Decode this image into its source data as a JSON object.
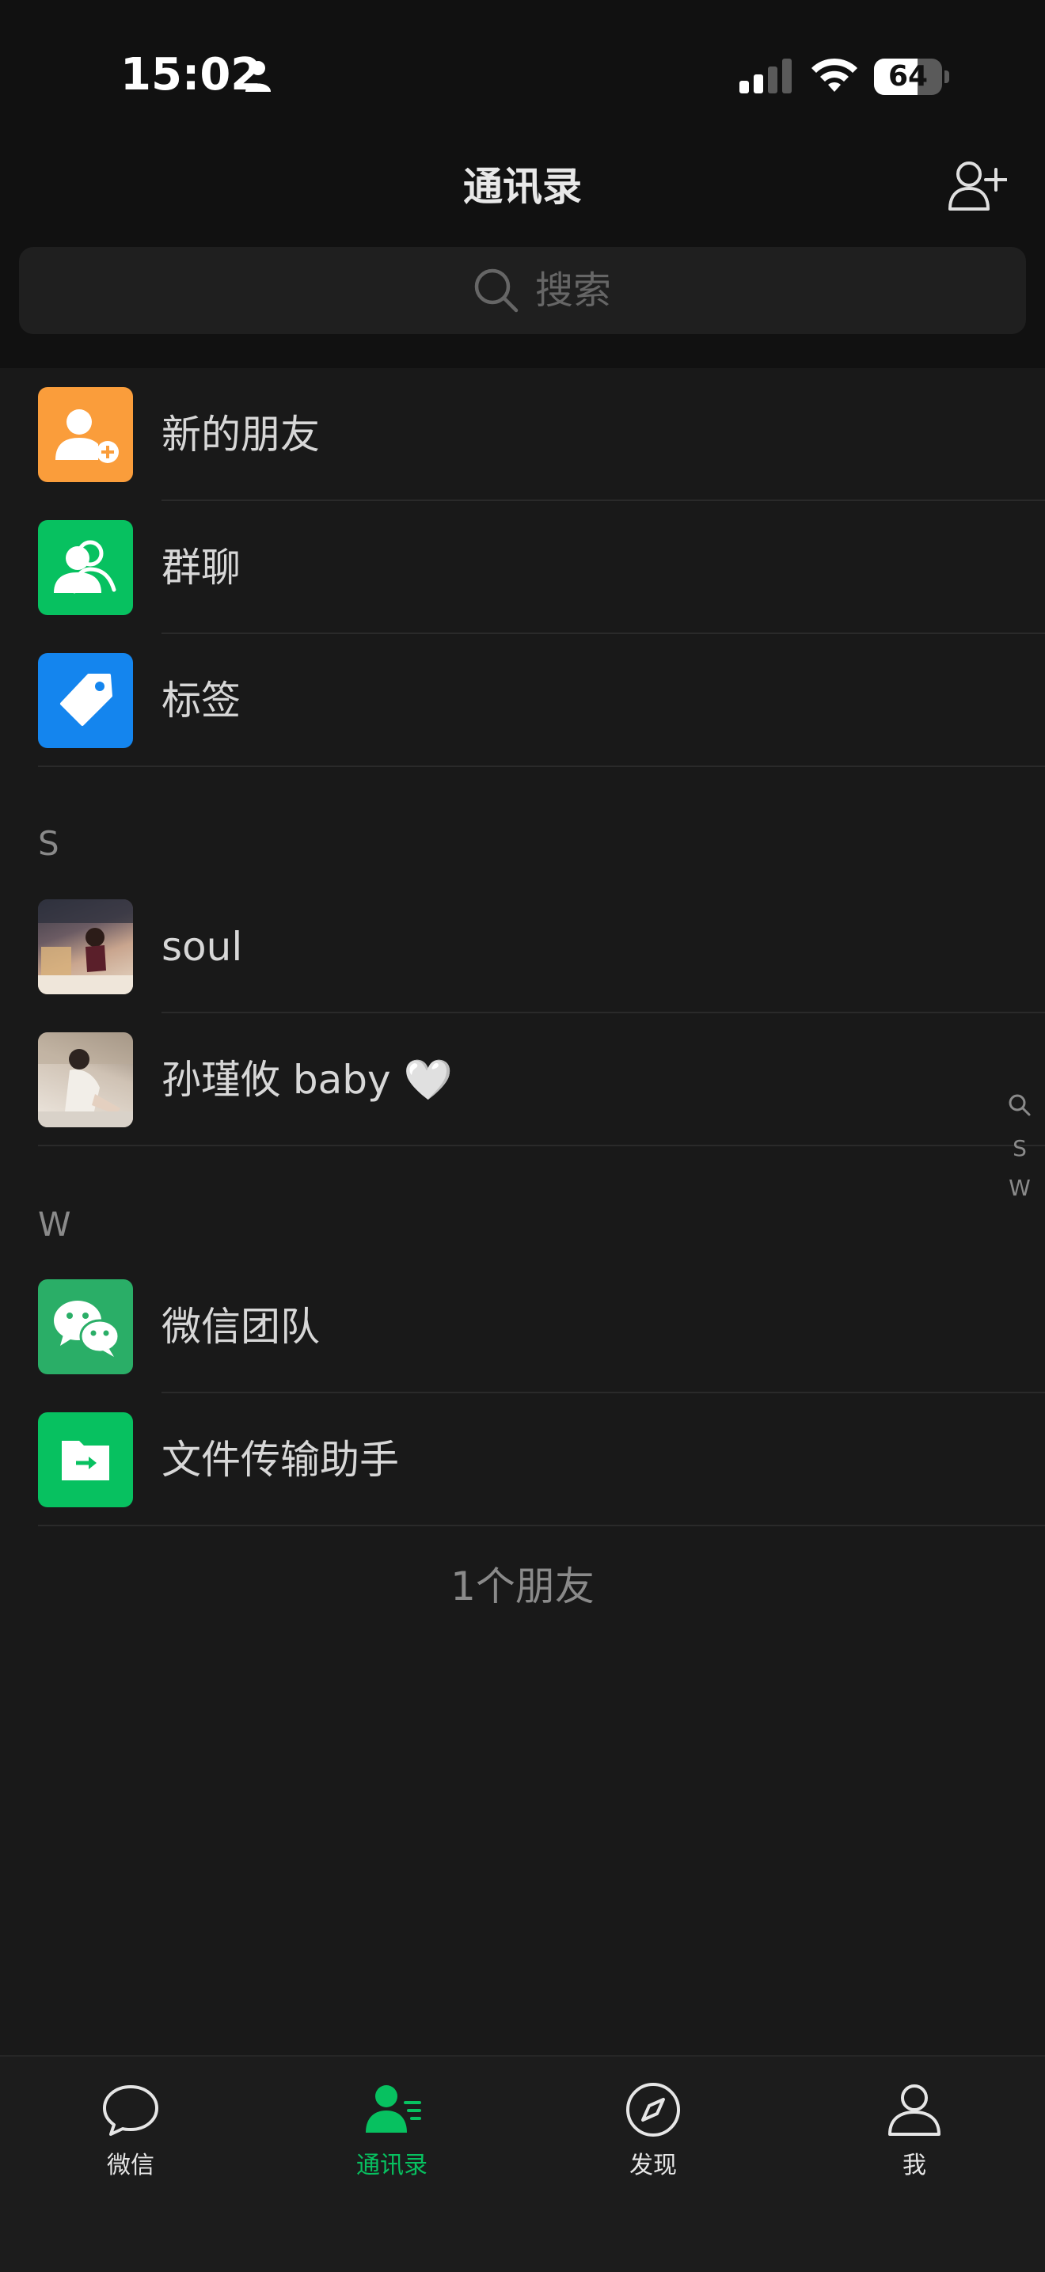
{
  "status_bar": {
    "time": "15:02",
    "battery": "64",
    "battery_level": 0.64
  },
  "header": {
    "title": "通讯录",
    "add_friend_icon": "add-contact-icon"
  },
  "search": {
    "placeholder": "搜索"
  },
  "system_items": [
    {
      "label": "新的朋友",
      "icon": "new-friend-icon",
      "color": "#fa9d3b"
    },
    {
      "label": "群聊",
      "icon": "group-chat-icon",
      "color": "#07c160"
    },
    {
      "label": "标签",
      "icon": "tag-icon",
      "color": "#1485ee"
    }
  ],
  "sections": [
    {
      "letter": "S",
      "contacts": [
        {
          "name": "soul"
        },
        {
          "name": "孙瑾攸 baby 🤍"
        }
      ]
    },
    {
      "letter": "W",
      "contacts": [
        {
          "name": "微信团队",
          "icon": "wechat-icon",
          "color": "#2aae67"
        },
        {
          "name": "文件传输助手",
          "icon": "file-transfer-icon",
          "color": "#07c160"
        }
      ]
    }
  ],
  "index_bar": [
    "S",
    "W"
  ],
  "friend_count": "1个朋友",
  "tabs": [
    {
      "label": "微信",
      "icon": "chat-icon",
      "active": false
    },
    {
      "label": "通讯录",
      "icon": "contacts-icon",
      "active": true
    },
    {
      "label": "发现",
      "icon": "discover-icon",
      "active": false
    },
    {
      "label": "我",
      "icon": "me-icon",
      "active": false
    }
  ],
  "colors": {
    "accent": "#07c160",
    "background": "#191919",
    "header_bg": "#111111"
  }
}
